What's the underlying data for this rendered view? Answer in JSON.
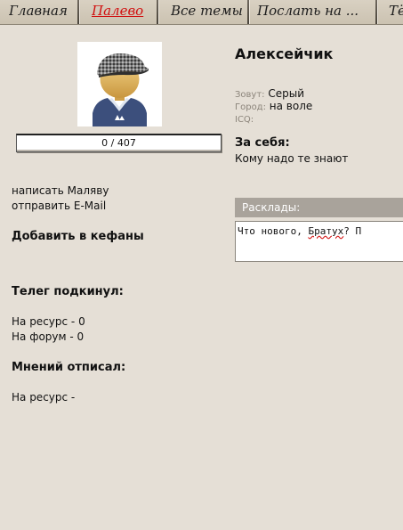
{
  "nav": {
    "tabs": [
      {
        "label": "Главная"
      },
      {
        "label": "Палево"
      },
      {
        "label": "Все темы"
      },
      {
        "label": "Послать на ..."
      },
      {
        "label": "Тё"
      }
    ]
  },
  "profile": {
    "rating": "0 / 407",
    "rating_fraction": 0,
    "actions": {
      "send_message": "написать Маляву",
      "send_email": "отправить E-Mail",
      "add_friend": "Добавить в кефаны"
    },
    "stats": {
      "posts_header": "Телег подкинул:",
      "resource_posts": "На ресурс - 0",
      "forum_posts": "На форум - 0",
      "comments_header": "Мнений отписал:",
      "resource_comments": "На ресурс -"
    },
    "name": "Алексейчик",
    "fields": {
      "name_label": "Зовут:",
      "name_value": "Серый",
      "city_label": "Город:",
      "city_value": "на воле",
      "icq_label": "ICQ:",
      "icq_value": ""
    },
    "about_header": "За себя:",
    "about_text": "Кому надо те знают",
    "rasklady_label": "Расклады:",
    "message_text_before": "Что нового, ",
    "message_text_misspelled": "Братух",
    "message_text_after": "? П"
  },
  "colors": {
    "background": "#e5dfd6",
    "active_tab": "#d10f0f",
    "rasklady_bar": "#a9a39b"
  }
}
